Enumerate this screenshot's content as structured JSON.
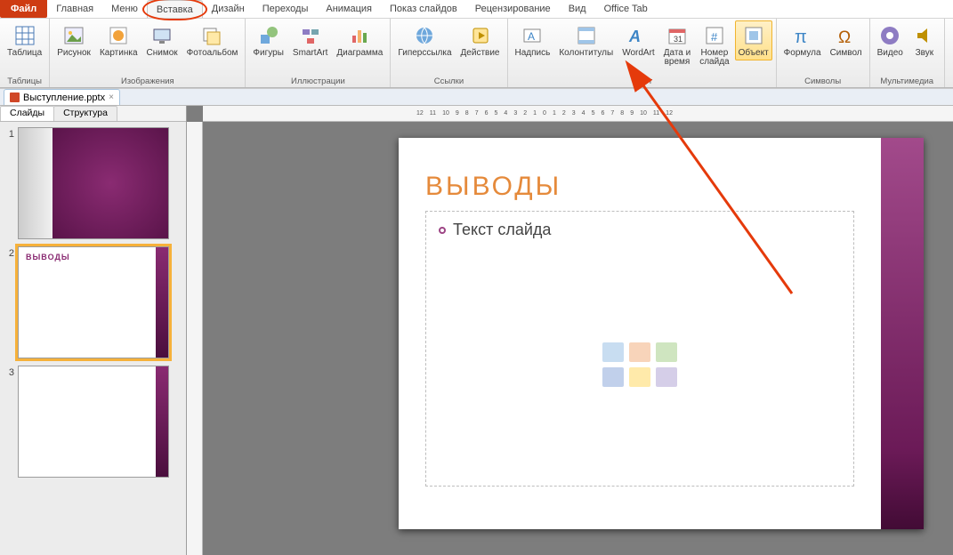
{
  "tabs": {
    "file": "Файл",
    "items": [
      "Главная",
      "Меню",
      "Вставка",
      "Дизайн",
      "Переходы",
      "Анимация",
      "Показ слайдов",
      "Рецензирование",
      "Вид",
      "Office Tab"
    ],
    "active_index": 2,
    "circled_index": 2
  },
  "ribbon": {
    "groups": [
      {
        "label": "Таблицы",
        "buttons": [
          {
            "name": "table-button",
            "label": "Таблица",
            "icon": "table"
          }
        ]
      },
      {
        "label": "Изображения",
        "buttons": [
          {
            "name": "picture-button",
            "label": "Рисунок",
            "icon": "picture"
          },
          {
            "name": "clipart-button",
            "label": "Картинка",
            "icon": "clipart"
          },
          {
            "name": "screenshot-button",
            "label": "Снимок",
            "icon": "screenshot"
          },
          {
            "name": "photoalbum-button",
            "label": "Фотоальбом",
            "icon": "photoalbum"
          }
        ]
      },
      {
        "label": "Иллюстрации",
        "buttons": [
          {
            "name": "shapes-button",
            "label": "Фигуры",
            "icon": "shapes"
          },
          {
            "name": "smartart-button",
            "label": "SmartArt",
            "icon": "smartart"
          },
          {
            "name": "chart-button",
            "label": "Диаграмма",
            "icon": "chart"
          }
        ]
      },
      {
        "label": "Ссылки",
        "buttons": [
          {
            "name": "hyperlink-button",
            "label": "Гиперссылка",
            "icon": "hyperlink"
          },
          {
            "name": "action-button",
            "label": "Действие",
            "icon": "action"
          }
        ]
      },
      {
        "label": "Текст",
        "buttons": [
          {
            "name": "textbox-button",
            "label": "Надпись",
            "icon": "textbox"
          },
          {
            "name": "headerfooter-button",
            "label": "Колонтитулы",
            "icon": "headerfooter"
          },
          {
            "name": "wordart-button",
            "label": "WordArt",
            "icon": "wordart"
          },
          {
            "name": "datetime-button",
            "label": "Дата и\nвремя",
            "icon": "datetime"
          },
          {
            "name": "slidenum-button",
            "label": "Номер\nслайда",
            "icon": "slidenum"
          },
          {
            "name": "object-button",
            "label": "Объект",
            "icon": "object",
            "highlight": true
          }
        ]
      },
      {
        "label": "Символы",
        "buttons": [
          {
            "name": "equation-button",
            "label": "Формула",
            "icon": "equation"
          },
          {
            "name": "symbol-button",
            "label": "Символ",
            "icon": "symbol"
          }
        ]
      },
      {
        "label": "Мультимедиа",
        "buttons": [
          {
            "name": "video-button",
            "label": "Видео",
            "icon": "video"
          },
          {
            "name": "audio-button",
            "label": "Звук",
            "icon": "audio"
          }
        ]
      }
    ]
  },
  "document_tab": {
    "name": "Выступление.pptx"
  },
  "panel": {
    "tabs": [
      "Слайды",
      "Структура"
    ],
    "active_index": 0,
    "slides": [
      {
        "num": "1",
        "kind": "title"
      },
      {
        "num": "2",
        "kind": "content",
        "title": "ВЫВОДЫ",
        "selected": true
      },
      {
        "num": "3",
        "kind": "blank"
      }
    ]
  },
  "slide": {
    "title": "Выводы",
    "placeholder_text": "Текст слайда"
  },
  "ruler_h": [
    "12",
    "11",
    "10",
    "9",
    "8",
    "7",
    "6",
    "5",
    "4",
    "3",
    "2",
    "1",
    "0",
    "1",
    "2",
    "3",
    "4",
    "5",
    "6",
    "7",
    "8",
    "9",
    "10",
    "11",
    "12"
  ]
}
